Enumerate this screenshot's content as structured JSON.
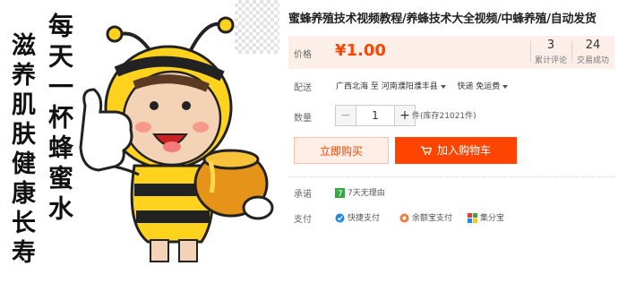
{
  "title": "蜜蜂养殖技术视频教程/养蜂技术大全视频/中蜂养殖/自动发货",
  "image": {
    "calligraphy_right": "每天一杯蜂蜜水",
    "calligraphy_left": "滋养肌肤健康长寿"
  },
  "price": {
    "label": "价格",
    "value": "¥1.00",
    "reviews_count": "3",
    "reviews_label": "累计评论",
    "sales_count": "24",
    "sales_label": "交易成功"
  },
  "delivery": {
    "label": "配送",
    "from": "广西北海",
    "to_word": "至",
    "to": "河南濮阳濮丰县",
    "method": "快递 免运费"
  },
  "quantity": {
    "label": "数量",
    "minus": "−",
    "value": "1",
    "plus": "+",
    "stock": "件(库存21021件)"
  },
  "buttons": {
    "buy_now": "立即购买",
    "add_to_cart": "加入购物车"
  },
  "promise": {
    "label": "承诺",
    "item": "7天无理由"
  },
  "payment": {
    "label": "支付",
    "methods": [
      "快捷支付",
      "余额宝支付",
      "集分宝"
    ]
  },
  "colors": {
    "accent": "#ff4400",
    "price_bg": "#fcefe9",
    "bee_yellow": "#ffd21e"
  }
}
